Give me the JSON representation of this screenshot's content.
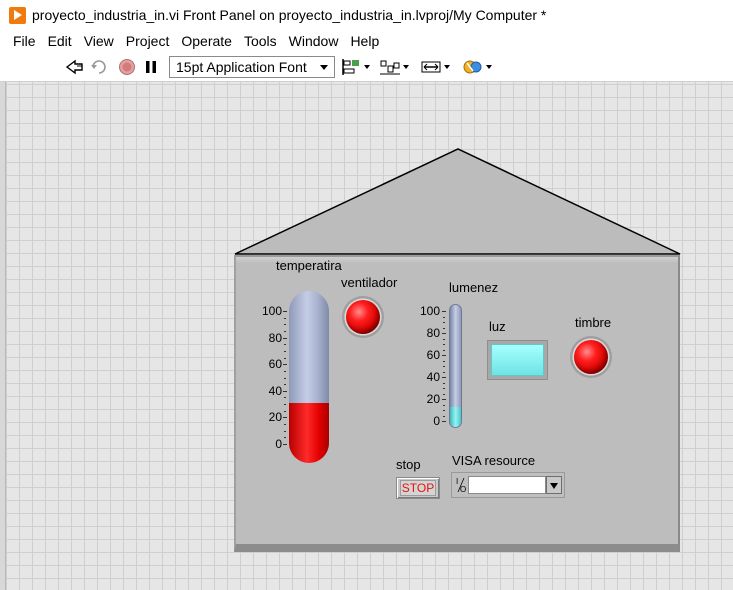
{
  "window": {
    "title": "proyecto_industria_in.vi Front Panel on proyecto_industria_in.lvproj/My Computer *"
  },
  "menu": [
    "File",
    "Edit",
    "View",
    "Project",
    "Operate",
    "Tools",
    "Window",
    "Help"
  ],
  "toolbar": {
    "font": "15pt Application Font",
    "icons": [
      "run-arrow-icon",
      "run-continuously-icon",
      "abort-icon",
      "pause-icon",
      "align-objects-icon",
      "distribute-objects-icon",
      "resize-objects-icon",
      "reorder-icon"
    ]
  },
  "panel": {
    "temperatura": {
      "label": "temperatira",
      "scale": [
        "100",
        "80",
        "60",
        "40",
        "20",
        "0"
      ],
      "value": 30,
      "max": 100
    },
    "ventilador": {
      "label": "ventilador",
      "state": "on"
    },
    "lumenez": {
      "label": "lumenez",
      "scale": [
        "100",
        "80",
        "60",
        "40",
        "20",
        "0"
      ],
      "value": 15,
      "max": 100
    },
    "luz": {
      "label": "luz"
    },
    "timbre": {
      "label": "timbre",
      "state": "on"
    },
    "stop": {
      "label": "stop",
      "button_text": "STOP"
    },
    "visa": {
      "label": "VISA resource",
      "io_glyph": "I/O",
      "value": ""
    }
  }
}
